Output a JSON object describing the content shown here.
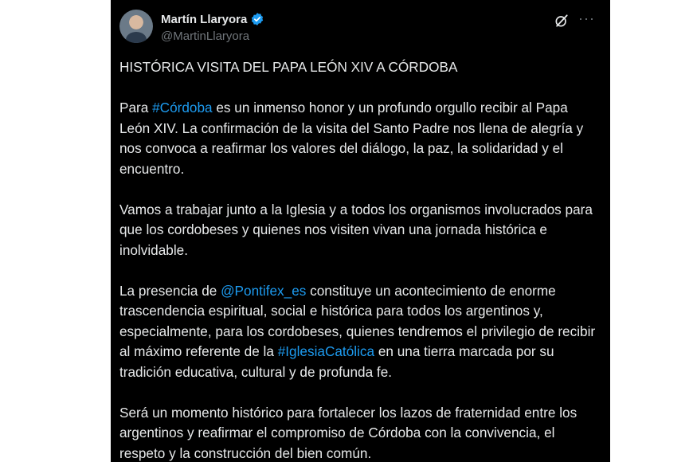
{
  "author": {
    "name": "Martín Llaryora",
    "handle": "@MartinLlaryora",
    "verified": true
  },
  "icons": [
    "verified-badge-icon",
    "grok-icon",
    "more-icon"
  ],
  "colors": {
    "background": "#000000",
    "text": "#e7e9ea",
    "link": "#1d9bf0",
    "muted": "#71767b"
  },
  "more_label": "···",
  "post": {
    "title": "HISTÓRICA VISITA DEL PAPA LEÓN XIV A CÓRDOBA",
    "p1_before": "Para ",
    "p1_tag": "#Córdoba",
    "p1_after": " es un inmenso honor y un profundo orgullo recibir al Papa León XIV. La confirmación de la visita del Santo Padre nos llena de alegría y nos convoca a reafirmar los valores del diálogo, la paz, la solidaridad y el encuentro.",
    "p2": "Vamos a trabajar junto a la Iglesia y a todos los organismos involucrados para que los cordobeses y quienes nos visiten vivan una jornada histórica e inolvidable.",
    "p3_before": "La presencia de ",
    "p3_mention": "@Pontifex_es",
    "p3_middle": " constituye un acontecimiento de enorme trascendencia espiritual, social e histórica para todos los argentinos y, especialmente, para los cordobeses, quienes tendremos el privilegio de recibir al máximo referente de la ",
    "p3_tag": "#IglesiaCatólica",
    "p3_after": " en una tierra marcada por su tradición educativa, cultural y de profunda fe.",
    "p4": "Será un momento histórico para fortalecer los lazos de fraternidad entre los argentinos y reafirmar el compromiso de Córdoba con la convivencia, el respeto y la construcción del bien común."
  }
}
